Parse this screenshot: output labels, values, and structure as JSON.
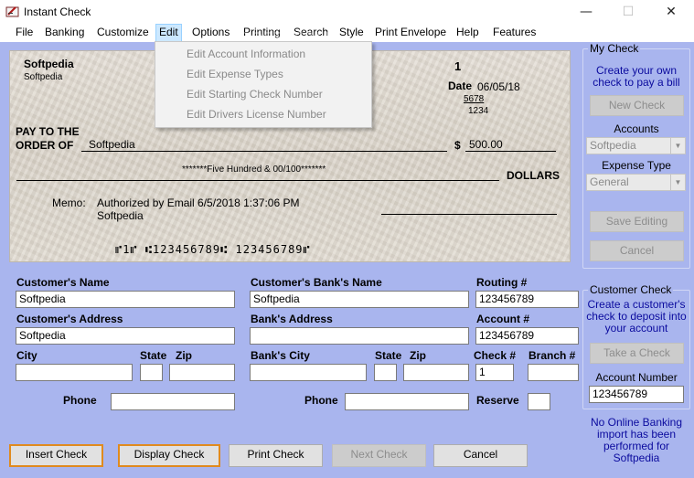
{
  "window": {
    "title": "Instant Check",
    "minimize": "—",
    "maximize": "☐",
    "close": "✕"
  },
  "menu": [
    "File",
    "Banking",
    "Customize",
    "Edit",
    "Options",
    "Printing",
    "Search",
    "Style",
    "Print Envelope",
    "Help",
    "Features"
  ],
  "edit_menu": [
    "Edit Account Information",
    "Edit Expense Types",
    "Edit Starting Check Number",
    "Edit Drivers License Number"
  ],
  "check": {
    "payer_name": "Softpedia",
    "payer_sub": "Softpedia",
    "check_number": "1",
    "date_label": "Date",
    "date": "06/05/18",
    "fraction_top": "5678",
    "fraction_bottom": "1234",
    "pay_to_line1": "PAY TO THE",
    "pay_to_line2": "ORDER OF",
    "payee": "Softpedia",
    "dollar_sign": "$",
    "amount": "500.00",
    "amount_words": "*******Five Hundred & 00/100*******",
    "dollars_label": "DOLLARS",
    "memo_label": "Memo:",
    "memo_line1": "Authorized by Email 6/5/2018 1:37:06 PM",
    "memo_line2": "Softpedia",
    "micr": "⑈1⑈  ⑆123456789⑆  123456789⑈"
  },
  "form": {
    "customer_name_label": "Customer's Name",
    "customer_name": "Softpedia",
    "bank_name_label": "Customer's Bank's Name",
    "bank_name": "Softpedia",
    "routing_label": "Routing #",
    "routing": "123456789",
    "customer_address_label": "Customer's Address",
    "customer_address": "Softpedia",
    "bank_address_label": "Bank's Address",
    "bank_address": "",
    "account_label": "Account #",
    "account": "123456789",
    "city_label": "City",
    "city": "",
    "state_label": "State",
    "state": "",
    "zip_label": "Zip",
    "zip": "",
    "bank_city_label": "Bank's City",
    "bank_city": "",
    "bank_state_label": "State",
    "bank_state": "",
    "bank_zip_label": "Zip",
    "bank_zip": "",
    "check_num_label": "Check #",
    "check_num": "1",
    "branch_label": "Branch #",
    "branch": "",
    "phone_label": "Phone",
    "phone": "",
    "bank_phone_label": "Phone",
    "bank_phone": "",
    "reserve_label": "Reserve",
    "reserve": ""
  },
  "buttons": {
    "insert": "Insert Check",
    "display": "Display Check",
    "print": "Print Check",
    "next": "Next Check",
    "cancel": "Cancel"
  },
  "my_check": {
    "title": "My Check",
    "desc_line1": "Create your own",
    "desc_line2": "check to pay a bill",
    "new_check": "New Check",
    "accounts_label": "Accounts",
    "accounts_value": "Softpedia",
    "expense_label": "Expense Type",
    "expense_value": "General",
    "save": "Save Editing",
    "cancel": "Cancel"
  },
  "customer_check": {
    "title": "Customer Check",
    "desc_line1": "Create a customer's",
    "desc_line2": "check to deposit into",
    "desc_line3": "your account",
    "take": "Take a Check",
    "account_number_label": "Account Number",
    "account_number": "123456789"
  },
  "banking_note": {
    "line1": "No Online Banking",
    "line2": "import has been",
    "line3": "performed for",
    "line4": "Softpedia"
  },
  "watermark": "SOFTPEDIA"
}
